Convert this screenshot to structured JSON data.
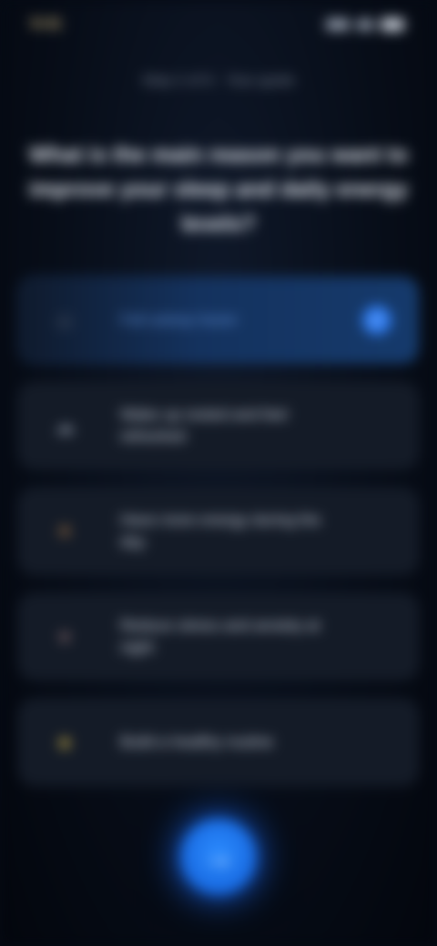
{
  "status_bar": {
    "time": "9:41"
  },
  "header": {
    "subtitle": "Step 2 of 6 · Your goals"
  },
  "question": {
    "text": "What is the main reason you want to improve your sleep and daily energy levels?"
  },
  "options": [
    {
      "icon": "target-icon",
      "glyph": "◎",
      "label": "Fall asleep faster",
      "selected": true
    },
    {
      "icon": "cloud-icon",
      "glyph": "☁",
      "label": "Wake up rested and feel refreshed",
      "selected": false
    },
    {
      "icon": "sun-icon",
      "glyph": "☀",
      "label": "Have more energy during the day",
      "selected": false
    },
    {
      "icon": "heart-icon",
      "glyph": "♥",
      "label": "Reduce stress and anxiety at night",
      "selected": false
    },
    {
      "icon": "star-icon",
      "glyph": "★",
      "label": "Build a healthy routine",
      "selected": false
    }
  ],
  "colors": {
    "accent": "#2f7cf0",
    "background": "#070d18",
    "card": "#141b27",
    "selected_card": "#14325e",
    "icon_colors": [
      "#4a5363",
      "#8e97a6",
      "#c98a4a",
      "#8a6c6e",
      "#d6b84a"
    ]
  },
  "footer": {
    "continue_icon": "arrow-right-icon",
    "continue_glyph": "→"
  }
}
